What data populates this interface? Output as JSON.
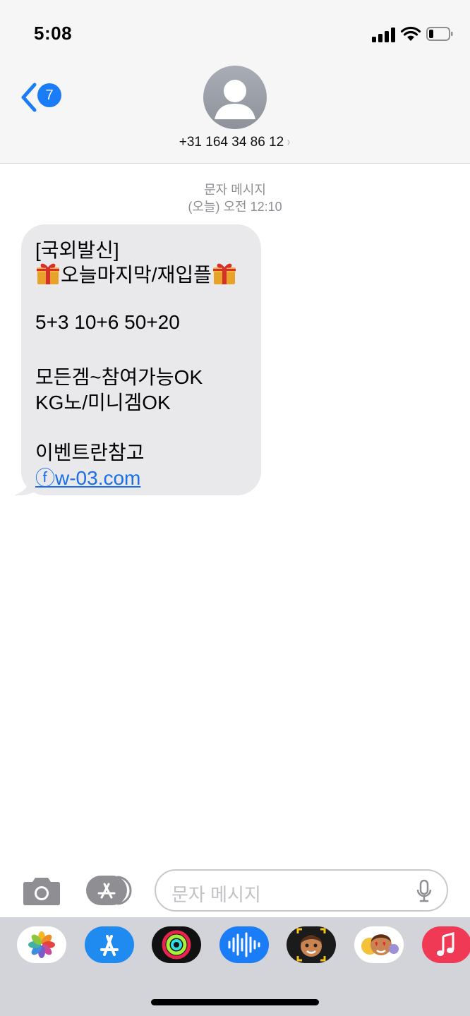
{
  "status_bar": {
    "time": "5:08",
    "icons": [
      "cellular-signal-icon",
      "wifi-icon",
      "battery-icon"
    ]
  },
  "nav": {
    "back_badge": "7",
    "contact": "+31 164 34 86 12",
    "contact_chevron": "›"
  },
  "thread": {
    "kind_label": "문자 메시지",
    "timestamp": "(오늘) 오전 12:10"
  },
  "message": {
    "line1": "[국외발신]",
    "line2": "오늘마지막/재입플",
    "line3": "5+3 10+6 50+20",
    "line4": "모든겜~참여가능OK",
    "line5": "KG노/미니겜OK",
    "line6": "이벤트란참고",
    "link": "ⓕw-03.com",
    "bubble_color": "#e9e9eb",
    "link_color": "#1a6ee8"
  },
  "composer": {
    "placeholder": "문자 메시지"
  },
  "app_drawer": {
    "apps": [
      "photos-icon",
      "app-store-icon",
      "activity-icon",
      "voice-memo-icon",
      "memoji-icon",
      "memoji-stickers-icon",
      "music-icon"
    ]
  },
  "colors": {
    "accent": "#1a7cf6",
    "header_bg": "#f6f6f6",
    "drawer_bg": "#d2d4d9"
  }
}
